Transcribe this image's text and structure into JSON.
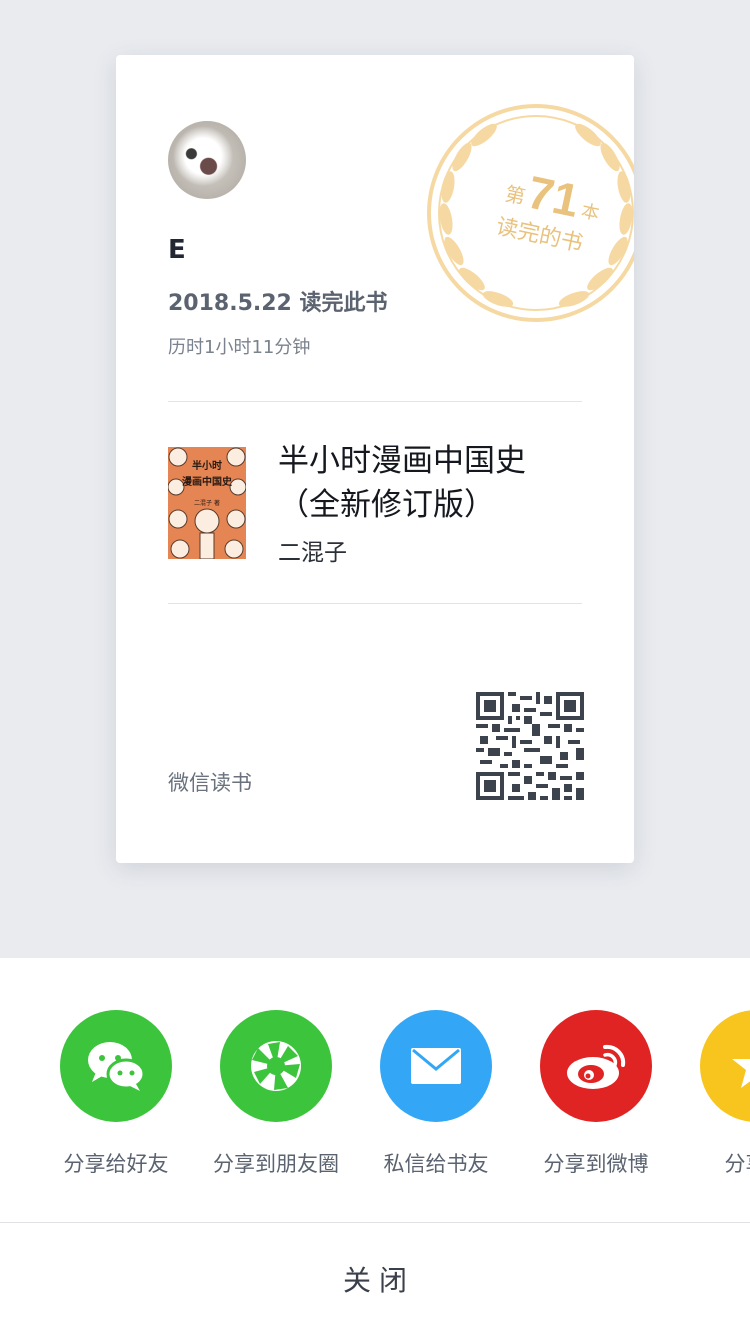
{
  "card": {
    "username": "E",
    "finish_date": "2018.5.22 读完此书",
    "duration": "历时1小时11分钟",
    "badge": {
      "prefix": "第",
      "number": "71",
      "suffix": "本",
      "caption": "读完的书"
    },
    "book": {
      "title": "半小时漫画中国史（全新修订版）",
      "author": "二混子",
      "cover_title_line1": "半小时",
      "cover_title_line2": "漫画中国史",
      "cover_author": "二混子 著"
    },
    "brand": "微信读书"
  },
  "share": {
    "items": [
      {
        "label": "分享给好友",
        "icon": "wechat-icon",
        "color": "#3cc43c"
      },
      {
        "label": "分享到朋友圈",
        "icon": "moments-icon",
        "color": "#3cc43c"
      },
      {
        "label": "私信给书友",
        "icon": "mail-icon",
        "color": "#33a7f5"
      },
      {
        "label": "分享到微博",
        "icon": "weibo-icon",
        "color": "#e02424"
      },
      {
        "label": "分享到",
        "icon": "star-icon",
        "color": "#f7c51e"
      }
    ],
    "close_label": "关闭"
  },
  "colors": {
    "background": "#e9ebef",
    "badge": "#f6d9a2",
    "badge_text": "#e9c27e"
  }
}
